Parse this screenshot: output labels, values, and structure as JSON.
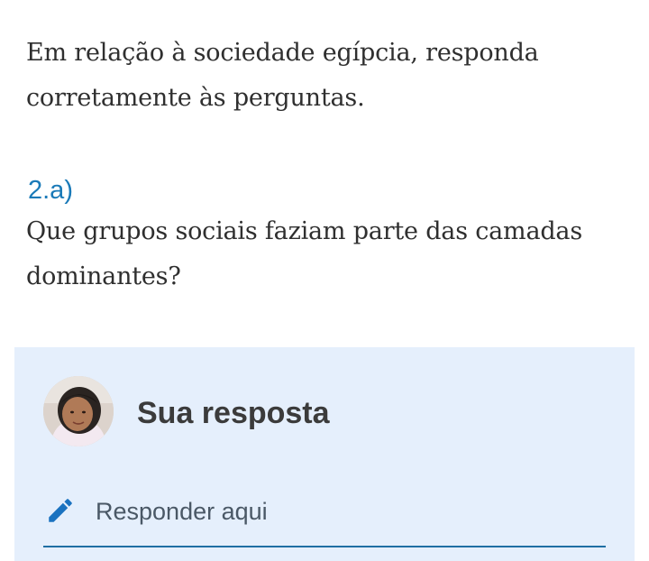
{
  "question": {
    "intro": "Em relação à sociedade egípcia, responda corretamente às perguntas.",
    "number": "2.a)",
    "text": "Que grupos sociais faziam parte das camadas dominantes?"
  },
  "answer": {
    "title": "Sua resposta",
    "placeholder": "Responder aqui",
    "avatar_icon": "user-avatar",
    "edit_icon": "pencil-icon",
    "accent_color": "#1a7ab8",
    "panel_color": "#e5effc"
  }
}
